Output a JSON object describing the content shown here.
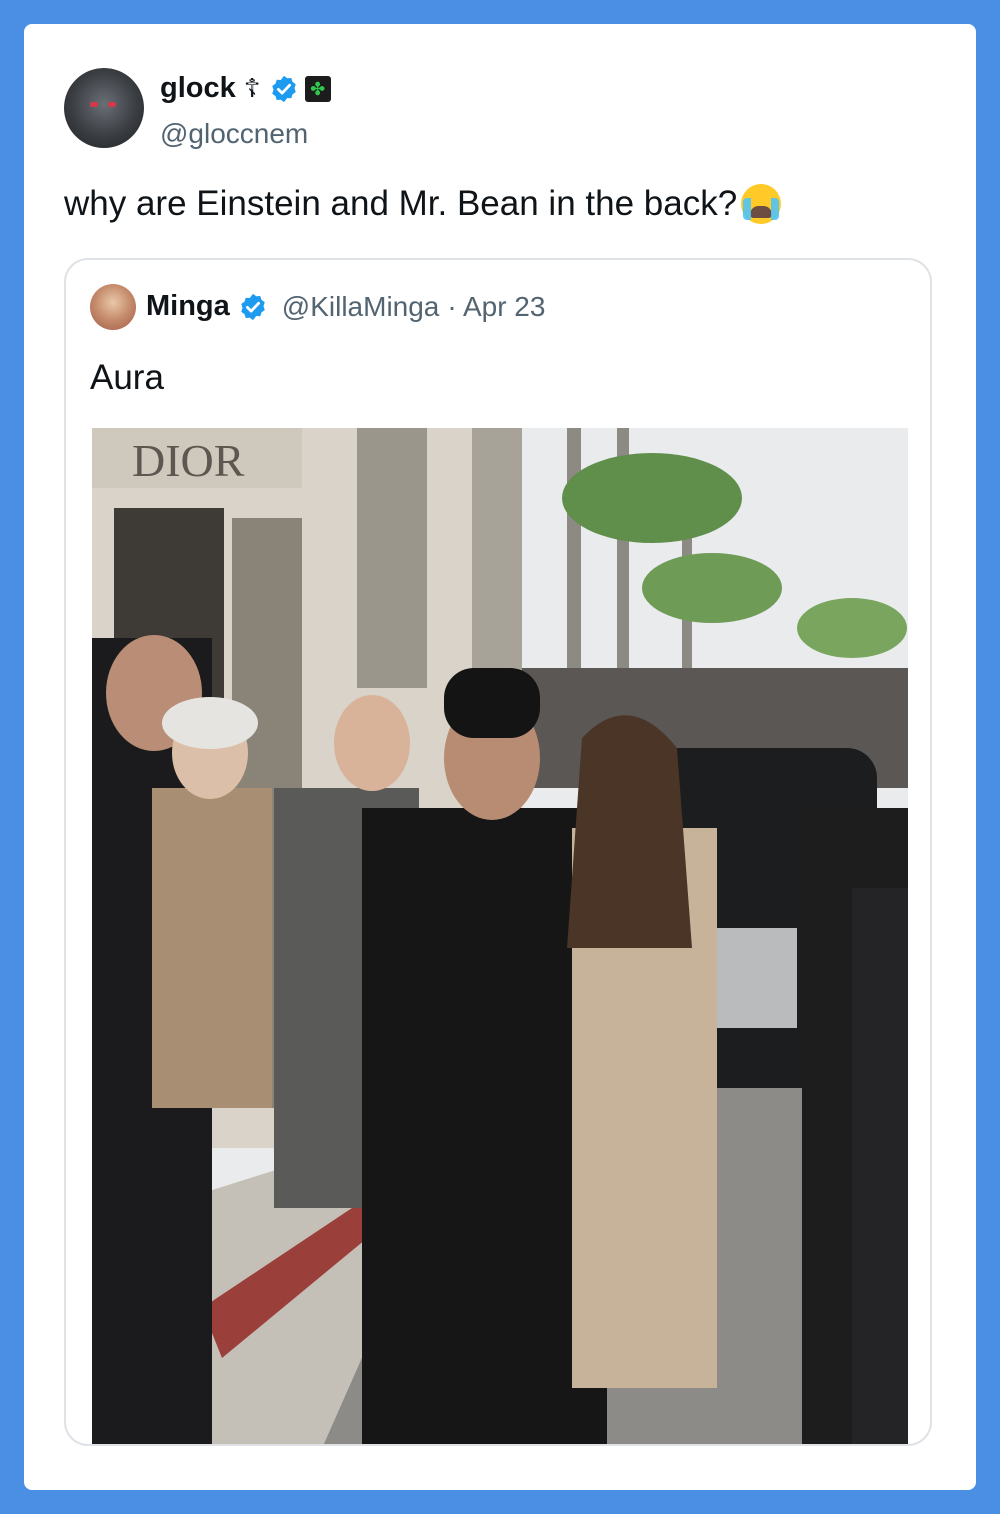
{
  "tweet": {
    "author_name": "glock",
    "author_cross": "☦",
    "author_handle": "@gloccnem",
    "text": "why are Einstein and Mr. Bean in the back?",
    "emoji": "😭",
    "verified_color": "#1d9bf0"
  },
  "quoted": {
    "author_name": "Minga",
    "author_handle": "@KillaMinga",
    "date": "· Apr 23",
    "text": "Aura",
    "photo": {
      "storefront_sign": "DIOR"
    }
  },
  "colors": {
    "background": "#4a8fe3",
    "card": "#ffffff",
    "text": "#0f1419",
    "secondary": "#536471"
  }
}
